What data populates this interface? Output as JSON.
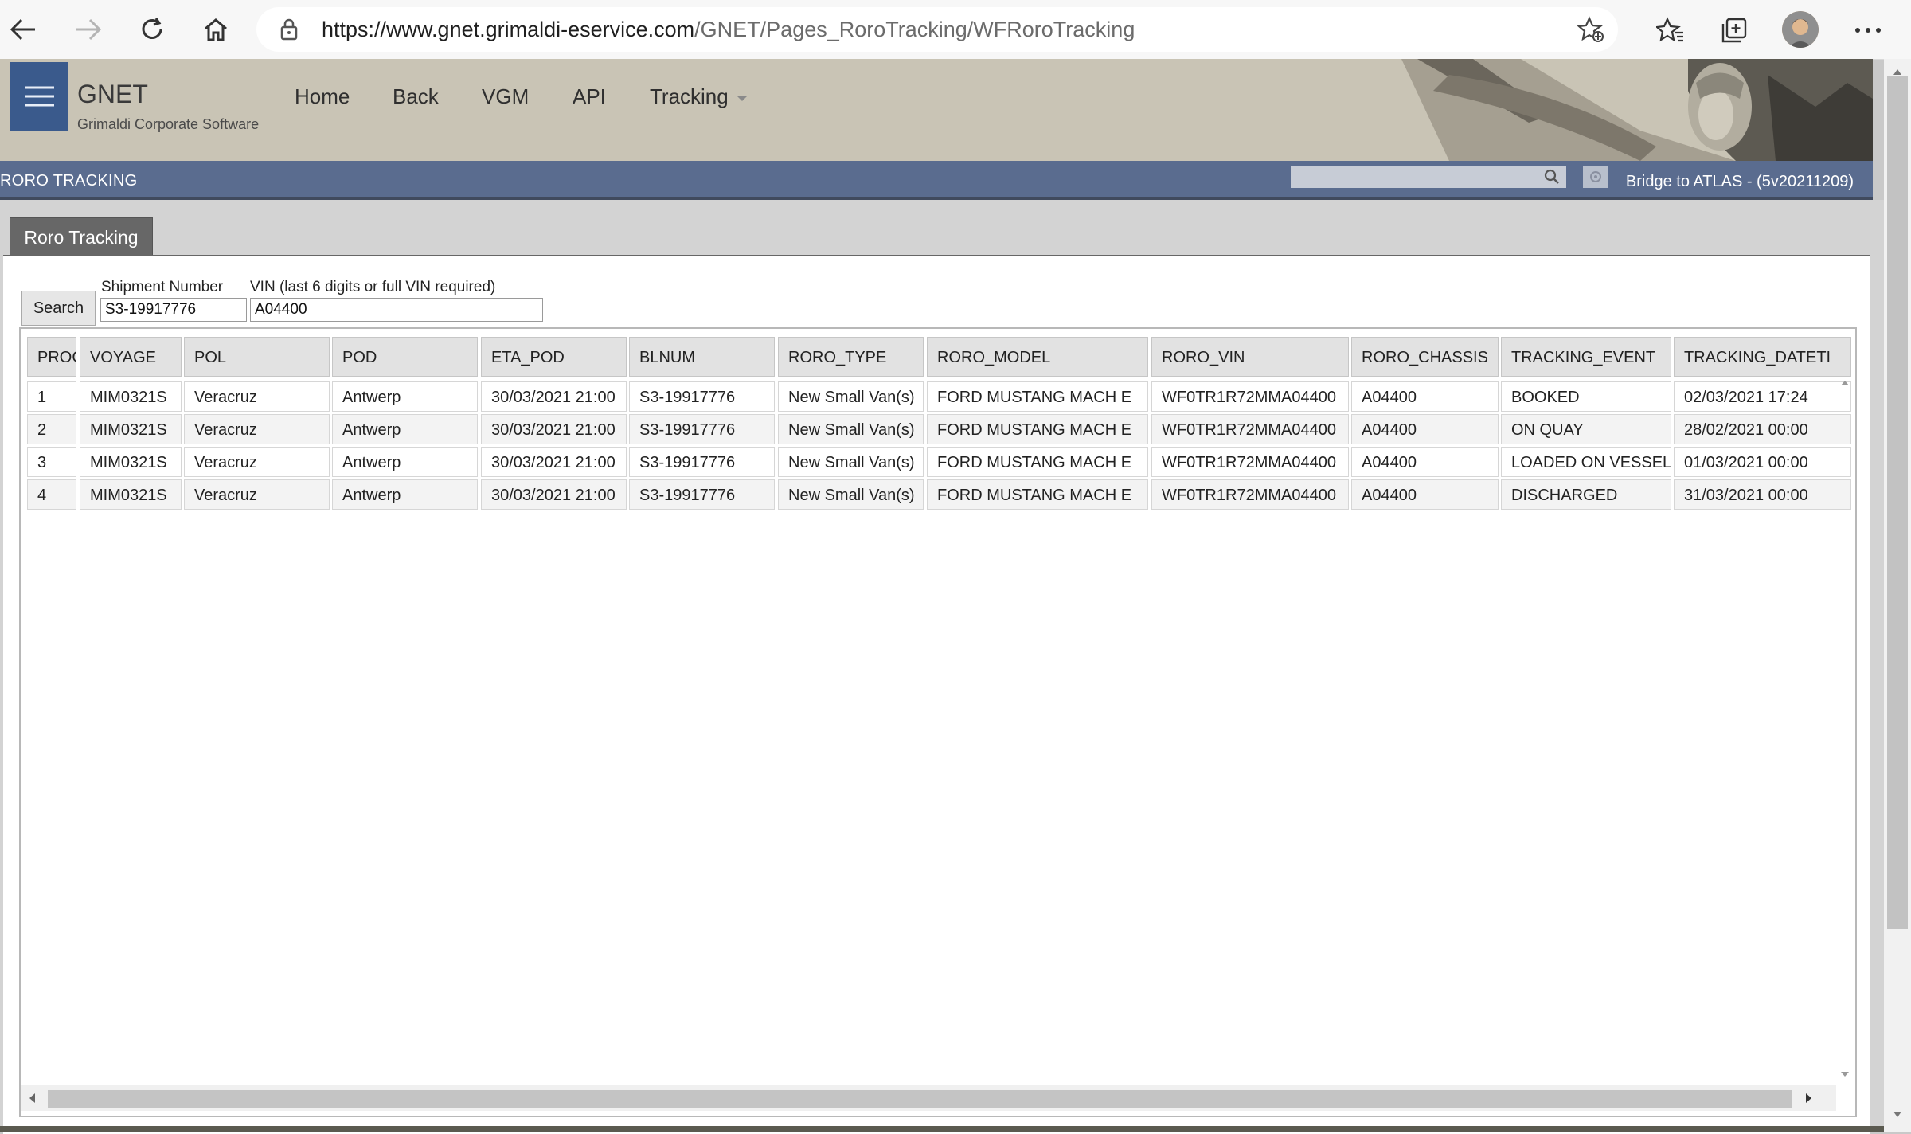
{
  "browser": {
    "url_host": "https://www.gnet.grimaldi-eservice.com",
    "url_path": "/GNET/Pages_RoroTracking/WFRoroTracking"
  },
  "app": {
    "brand_title": "GNET",
    "brand_subtitle": "Grimaldi Corporate Software",
    "menu": {
      "home": "Home",
      "back": "Back",
      "vgm": "VGM",
      "api": "API",
      "tracking": "Tracking"
    },
    "subbar_title": "RORO TRACKING",
    "version": "Bridge to ATLAS - (5v20211209)"
  },
  "page": {
    "tab_label": "Roro Tracking",
    "search_label": "Search",
    "shipment_label": "Shipment Number",
    "shipment_value": "S3-19917776",
    "vin_label": "VIN (last 6 digits or full VIN required)",
    "vin_value": "A04400"
  },
  "table": {
    "headers": [
      "PROG",
      "VOYAGE",
      "POL",
      "POD",
      "ETA_POD",
      "BLNUM",
      "RORO_TYPE",
      "RORO_MODEL",
      "RORO_VIN",
      "RORO_CHASSIS",
      "TRACKING_EVENT",
      "TRACKING_DATETI"
    ],
    "rows": [
      [
        "1",
        "MIM0321S",
        "Veracruz",
        "Antwerp",
        "30/03/2021 21:00",
        "S3-19917776",
        "New Small Van(s)",
        "FORD MUSTANG MACH E",
        "WF0TR1R72MMA04400",
        "A04400",
        "BOOKED",
        "02/03/2021 17:24"
      ],
      [
        "2",
        "MIM0321S",
        "Veracruz",
        "Antwerp",
        "30/03/2021 21:00",
        "S3-19917776",
        "New Small Van(s)",
        "FORD MUSTANG MACH E",
        "WF0TR1R72MMA04400",
        "A04400",
        "ON QUAY",
        "28/02/2021 00:00"
      ],
      [
        "3",
        "MIM0321S",
        "Veracruz",
        "Antwerp",
        "30/03/2021 21:00",
        "S3-19917776",
        "New Small Van(s)",
        "FORD MUSTANG MACH E",
        "WF0TR1R72MMA04400",
        "A04400",
        "LOADED ON VESSEL",
        "01/03/2021 00:00"
      ],
      [
        "4",
        "MIM0321S",
        "Veracruz",
        "Antwerp",
        "30/03/2021 21:00",
        "S3-19917776",
        "New Small Van(s)",
        "FORD MUSTANG MACH E",
        "WF0TR1R72MMA04400",
        "A04400",
        "DISCHARGED",
        "31/03/2021 00:00"
      ]
    ]
  },
  "icons": {
    "back": "back-arrow-icon",
    "forward": "forward-arrow-icon",
    "refresh": "refresh-icon",
    "home": "home-icon",
    "lock": "lock-icon",
    "add_favorite": "add-favorite-icon",
    "favorites": "favorites-icon",
    "collections": "collections-icon",
    "profile": "profile-avatar",
    "more": "more-icon",
    "menu": "hamburger-icon",
    "search": "search-icon"
  },
  "colors": {
    "header_bg": "#c9c4b5",
    "hamburger_bg": "#3a5a8c",
    "subbar_bg": "#5a6c8f",
    "tab_bg": "#676767"
  }
}
